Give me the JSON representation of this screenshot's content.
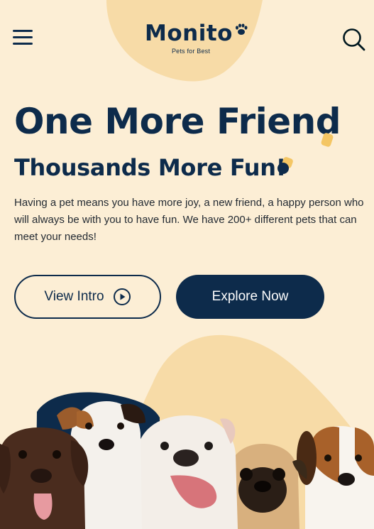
{
  "header": {
    "logo_text": "Monito",
    "logo_tagline": "Pets for Best"
  },
  "hero": {
    "headline": "One More Friend",
    "subheadline": "Thousands More Fun!",
    "description": "Having a pet means you have more joy, a new friend, a happy person who will always be with you to have fun. We have 200+ different pets that can meet your needs!"
  },
  "buttons": {
    "view_intro_label": "View Intro",
    "explore_label": "Explore Now"
  },
  "icons": {
    "menu": "hamburger-menu-icon",
    "search": "search-icon",
    "play": "play-circle-icon",
    "paw": "paw-icon"
  },
  "colors": {
    "background": "#FCEED5",
    "blob": "#F7DBA7",
    "primary": "#0D2B4B",
    "text": "#242B33",
    "button_text_light": "#FDFDFD"
  }
}
